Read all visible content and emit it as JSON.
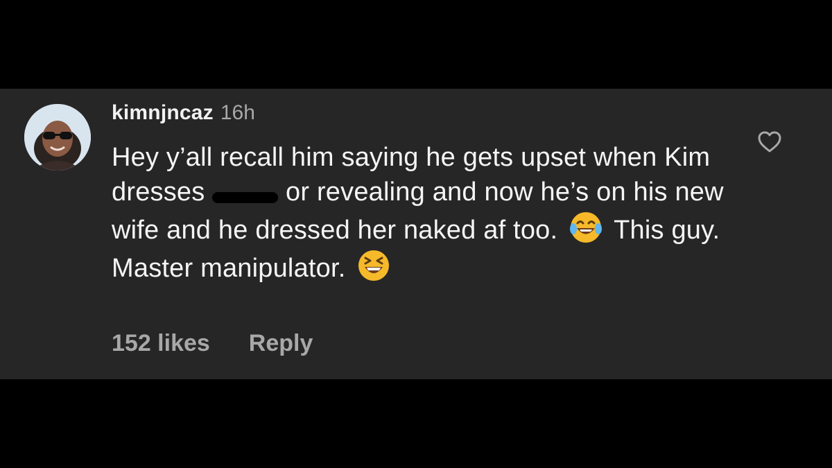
{
  "comment": {
    "username": "kimnjncaz",
    "timestamp": "16h",
    "text_segments": {
      "part1": "Hey y’all recall him saying he gets upset when Kim dresses",
      "part2": "or revealing and now he’s on his new wife and he dressed her naked af too.",
      "part3": "This guy. Master manipulator."
    },
    "likes_label": "152 likes",
    "reply_label": "Reply"
  },
  "icons": {
    "heart": "heart-outline-icon",
    "emoji1": "face-with-tears-of-joy-emoji",
    "emoji2": "grinning-squinting-face-emoji"
  },
  "colors": {
    "panel_background": "#262626",
    "page_background": "#000000",
    "primary_text": "#f5f5f5",
    "secondary_text": "#a8a8a8"
  }
}
